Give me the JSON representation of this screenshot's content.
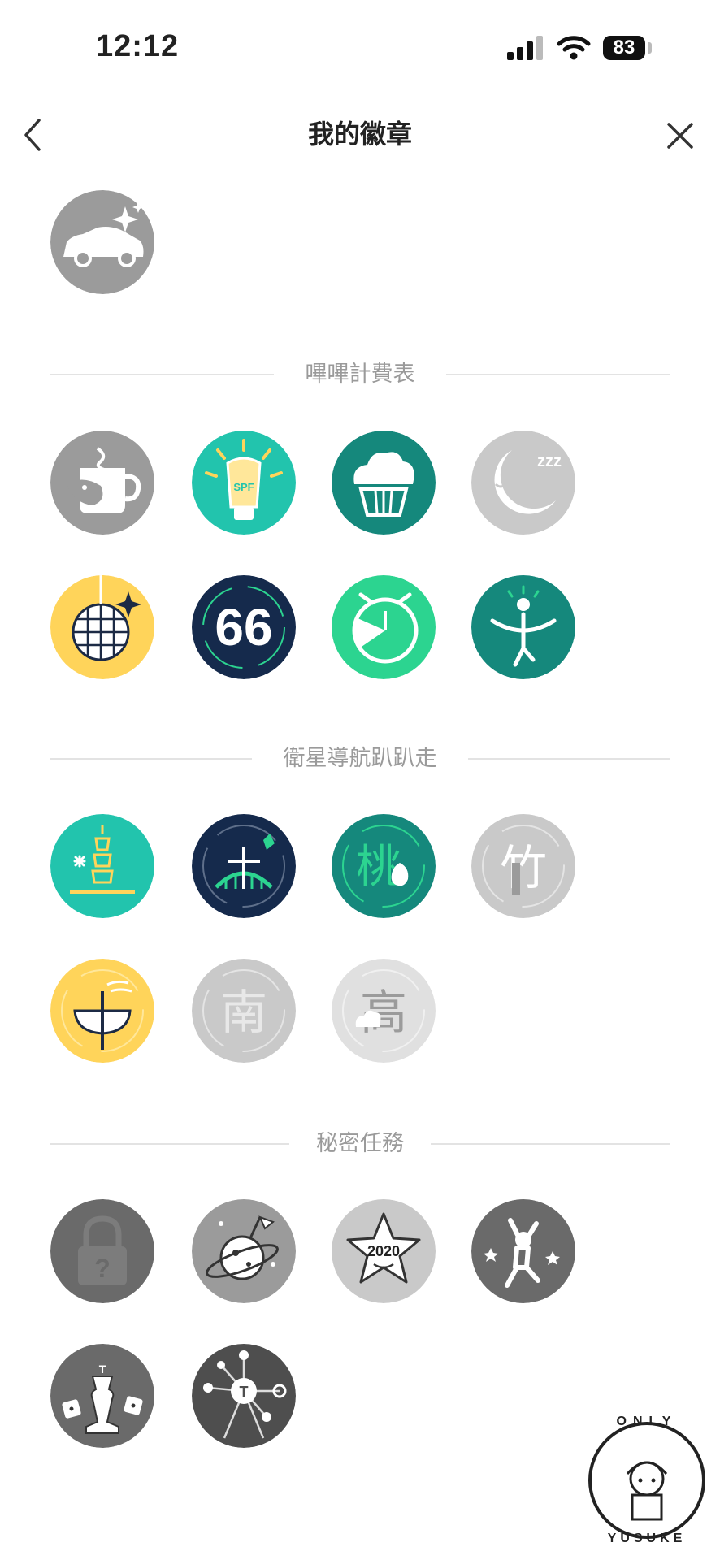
{
  "status_bar": {
    "time": "12:12",
    "battery": "83"
  },
  "nav": {
    "title": "我的徽章"
  },
  "icons": {
    "back": "chevron-left-icon",
    "close": "close-icon"
  },
  "top_badge": {
    "icon": "car-sparkle-icon",
    "state": "locked"
  },
  "sections": [
    {
      "title": "嗶嗶計費表",
      "badges": [
        {
          "icon": "bird-mug-icon",
          "state": "locked"
        },
        {
          "icon": "sunscreen-icon",
          "label": "SPF",
          "state": "earned"
        },
        {
          "icon": "cupcake-icon",
          "state": "earned"
        },
        {
          "icon": "moon-sleep-icon",
          "label": "zzz",
          "state": "locked"
        },
        {
          "icon": "disco-ball-icon",
          "state": "earned"
        },
        {
          "icon": "number-66-icon",
          "label": "66",
          "state": "earned"
        },
        {
          "icon": "alarm-clock-icon",
          "state": "earned"
        },
        {
          "icon": "yoga-person-icon",
          "state": "earned"
        }
      ]
    },
    {
      "title": "衛星導航趴趴走",
      "badges": [
        {
          "icon": "taipei-101-icon",
          "state": "earned"
        },
        {
          "icon": "new-taipei-bridge-icon",
          "state": "earned"
        },
        {
          "icon": "taoyuan-peach-icon",
          "label": "桃",
          "state": "earned"
        },
        {
          "icon": "hsinchu-bamboo-icon",
          "label": "竹",
          "state": "locked"
        },
        {
          "icon": "taichung-bowl-icon",
          "label": "中",
          "state": "earned"
        },
        {
          "icon": "tainan-gate-icon",
          "label": "南",
          "state": "locked"
        },
        {
          "icon": "kaohsiung-city-icon",
          "label": "高",
          "state": "locked"
        }
      ]
    },
    {
      "title": "秘密任務",
      "badges": [
        {
          "icon": "padlock-question-icon",
          "label": "?",
          "state": "locked"
        },
        {
          "icon": "planet-flag-icon",
          "state": "locked"
        },
        {
          "icon": "star-2020-icon",
          "label": "2020",
          "state": "locked"
        },
        {
          "icon": "jumping-person-icon",
          "state": "locked"
        },
        {
          "icon": "chess-king-dice-icon",
          "label": "T",
          "state": "locked"
        },
        {
          "icon": "network-t-icon",
          "label": "T",
          "state": "locked"
        }
      ]
    }
  ],
  "watermark": {
    "top_text": "ONLY",
    "bottom_text": "YUSUKE"
  },
  "colors": {
    "teal_bright": "#22c4ad",
    "teal_dark": "#15887c",
    "navy": "#152a4c",
    "green": "#2cd490",
    "yellow": "#ffd45a",
    "gray": "#9b9b9b",
    "gray_light": "#c9c9c9",
    "gray_lighter": "#e0e0e0",
    "gray_dark": "#6a6a6a"
  }
}
